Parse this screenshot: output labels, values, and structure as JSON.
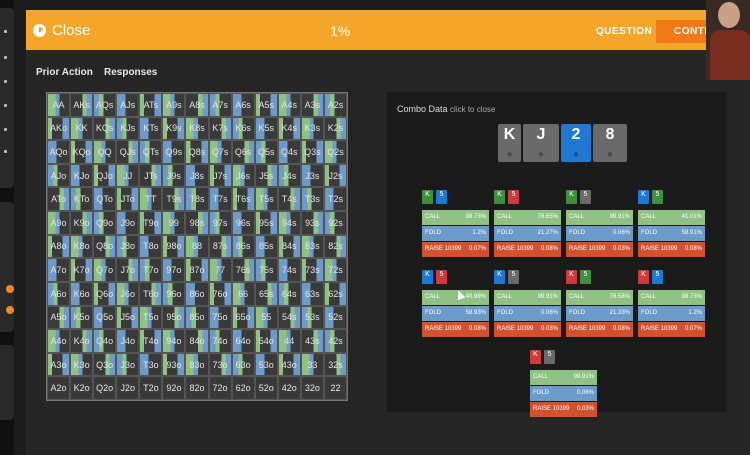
{
  "topbar": {
    "close_label": "Close",
    "progress_text": "1%",
    "question_label": "QUESTION",
    "continue_label": "CONTIN"
  },
  "tabs": [
    "Prior Action",
    "Responses"
  ],
  "grid_rows": [
    [
      "AA",
      "AKs",
      "AQs",
      "AJs",
      "ATs",
      "A9s",
      "A8s",
      "A7s",
      "A6s",
      "A5s",
      "A4s",
      "A3s",
      "A2s"
    ],
    [
      "AKo",
      "KK",
      "KQs",
      "KJs",
      "KTs",
      "K9s",
      "K8s",
      "K7s",
      "K6s",
      "K5s",
      "K4s",
      "K3s",
      "K2s"
    ],
    [
      "AQo",
      "KQo",
      "QQ",
      "QJs",
      "QTs",
      "Q9s",
      "Q8s",
      "Q7s",
      "Q6s",
      "Q5s",
      "Q4s",
      "Q3s",
      "Q2s"
    ],
    [
      "AJo",
      "KJo",
      "QJo",
      "JJ",
      "JTs",
      "J9s",
      "J8s",
      "J7s",
      "J6s",
      "J5s",
      "J4s",
      "J3s",
      "J2s"
    ],
    [
      "ATo",
      "KTo",
      "QTo",
      "JTo",
      "TT",
      "T9s",
      "T8s",
      "T7s",
      "T6s",
      "T5s",
      "T4s",
      "T3s",
      "T2s"
    ],
    [
      "A9o",
      "K9o",
      "Q9o",
      "J9o",
      "T9o",
      "99",
      "98s",
      "97s",
      "96s",
      "95s",
      "94s",
      "93s",
      "92s"
    ],
    [
      "A8o",
      "K8o",
      "Q8o",
      "J8o",
      "T8o",
      "98o",
      "88",
      "87s",
      "86s",
      "85s",
      "84s",
      "83s",
      "82s"
    ],
    [
      "A7o",
      "K7o",
      "Q7o",
      "J7o",
      "T7o",
      "97o",
      "87o",
      "77",
      "76s",
      "75s",
      "74s",
      "73s",
      "72s"
    ],
    [
      "A6o",
      "K6o",
      "Q6o",
      "J6o",
      "T6o",
      "96o",
      "86o",
      "76o",
      "66",
      "65s",
      "64s",
      "63s",
      "62s"
    ],
    [
      "A5o",
      "K5o",
      "Q5o",
      "J5o",
      "T5o",
      "95o",
      "85o",
      "75o",
      "65o",
      "55",
      "54s",
      "53s",
      "52s"
    ],
    [
      "A4o",
      "K4o",
      "Q4o",
      "J4o",
      "T4o",
      "94o",
      "84o",
      "74o",
      "64o",
      "54o",
      "44",
      "43s",
      "42s"
    ],
    [
      "A3o",
      "K3o",
      "Q3o",
      "J3o",
      "T3o",
      "93o",
      "83o",
      "73o",
      "63o",
      "53o",
      "43o",
      "33",
      "32s"
    ],
    [
      "A2o",
      "K2o",
      "Q2o",
      "J2o",
      "T2o",
      "92o",
      "82o",
      "72o",
      "62o",
      "52o",
      "42o",
      "32o",
      "22"
    ]
  ],
  "grid_colors": {
    "call": "#8fc183",
    "fold": "#6d9bc9",
    "raise": "#d2522e",
    "cell": "#3a3a3a"
  },
  "combo_panel": {
    "title": "Combo Data",
    "subtitle": "click to close",
    "board": [
      {
        "rank": "K",
        "color": "#6a6a6a"
      },
      {
        "rank": "J",
        "color": "#6a6a6a"
      },
      {
        "rank": "2",
        "color": "#1f78d1"
      },
      {
        "rank": "8",
        "color": "#6a6a6a"
      }
    ],
    "combos": [
      {
        "cards": [
          {
            "rank": "K",
            "color": "#3f8f3f"
          },
          {
            "rank": "5",
            "color": "#1f78d1"
          }
        ],
        "call": "98.73%",
        "fold": "1.2%",
        "raise_label": "RAISE 10399",
        "raise": "0.07%"
      },
      {
        "cards": [
          {
            "rank": "K",
            "color": "#3f8f3f"
          },
          {
            "rank": "5",
            "color": "#d13a3a"
          }
        ],
        "call": "78.65%",
        "fold": "21.27%",
        "raise_label": "RAISE 10399",
        "raise": "0.08%"
      },
      {
        "cards": [
          {
            "rank": "K",
            "color": "#3f8f3f"
          },
          {
            "rank": "5",
            "color": "#6a6a6a"
          }
        ],
        "call": "99.91%",
        "fold": "0.06%",
        "raise_label": "RAISE 10399",
        "raise": "0.03%"
      },
      {
        "cards": [
          {
            "rank": "K",
            "color": "#1f78d1"
          },
          {
            "rank": "5",
            "color": "#3f8f3f"
          }
        ],
        "call": "41.01%",
        "fold": "58.91%",
        "raise_label": "RAISE 10399",
        "raise": "0.08%"
      },
      {
        "cards": [
          {
            "rank": "K",
            "color": "#1f78d1"
          },
          {
            "rank": "5",
            "color": "#d13a3a"
          }
        ],
        "call": "40.99%",
        "fold": "58.93%",
        "raise_label": "RAISE 10399",
        "raise": "0.08%"
      },
      {
        "cards": [
          {
            "rank": "K",
            "color": "#1f78d1"
          },
          {
            "rank": "5",
            "color": "#6a6a6a"
          }
        ],
        "call": "99.91%",
        "fold": "0.06%",
        "raise_label": "RAISE 10399",
        "raise": "0.03%"
      },
      {
        "cards": [
          {
            "rank": "K",
            "color": "#d13a3a"
          },
          {
            "rank": "5",
            "color": "#3f8f3f"
          }
        ],
        "call": "78.58%",
        "fold": "21.33%",
        "raise_label": "RAISE 10399",
        "raise": "0.08%"
      },
      {
        "cards": [
          {
            "rank": "K",
            "color": "#d13a3a"
          },
          {
            "rank": "5",
            "color": "#1f78d1"
          }
        ],
        "call": "98.73%",
        "fold": "1.2%",
        "raise_label": "RAISE 10399",
        "raise": "0.07%"
      },
      {
        "cards": [
          {
            "rank": "K",
            "color": "#d13a3a"
          },
          {
            "rank": "5",
            "color": "#6a6a6a"
          }
        ],
        "call": "99.91%",
        "fold": "0.06%",
        "raise_label": "RAISE 10399",
        "raise": "0.03%"
      }
    ]
  }
}
